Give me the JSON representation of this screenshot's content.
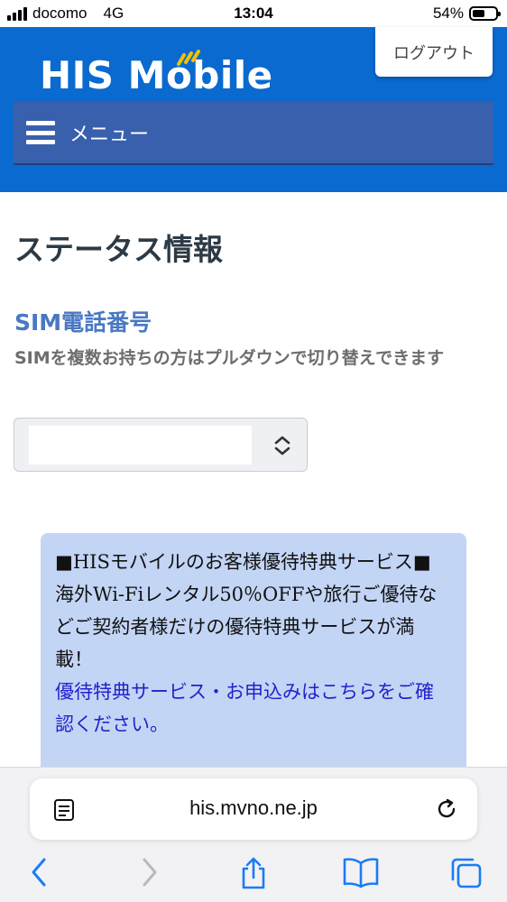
{
  "status_bar": {
    "carrier": "docomo",
    "network": "4G",
    "time": "13:04",
    "battery_percent_text": "54%",
    "battery_level": 0.54
  },
  "header": {
    "logo_text": "HIS Mobile",
    "logout_label": "ログアウト",
    "menu_label": "メニュー",
    "background_color": "#0a6ad0",
    "menu_bar_color": "#3960ad"
  },
  "main": {
    "page_title": "ステータス情報",
    "section_title": "SIM電話番号",
    "section_desc": "SIMを複数お持ちの方はプルダウンで切り替えできます",
    "sim_select_value": ""
  },
  "promo": {
    "heading": "■HISモバイルのお客様優待特典サービス■",
    "body": "海外Wi-Fiレンタル50％OFFや旅行ご優待などご契約者様だけの優待特典サービスが満載！",
    "link_text": "優待特典サービス・お申込みはこちらをご確認ください。",
    "background_color": "#c3d5f5",
    "link_color": "#2222cc"
  },
  "browser": {
    "url": "his.mvno.ne.jp",
    "icons": [
      "reader-icon",
      "reload-icon",
      "back-icon",
      "forward-icon",
      "share-icon",
      "bookmarks-icon",
      "tabs-icon"
    ]
  }
}
